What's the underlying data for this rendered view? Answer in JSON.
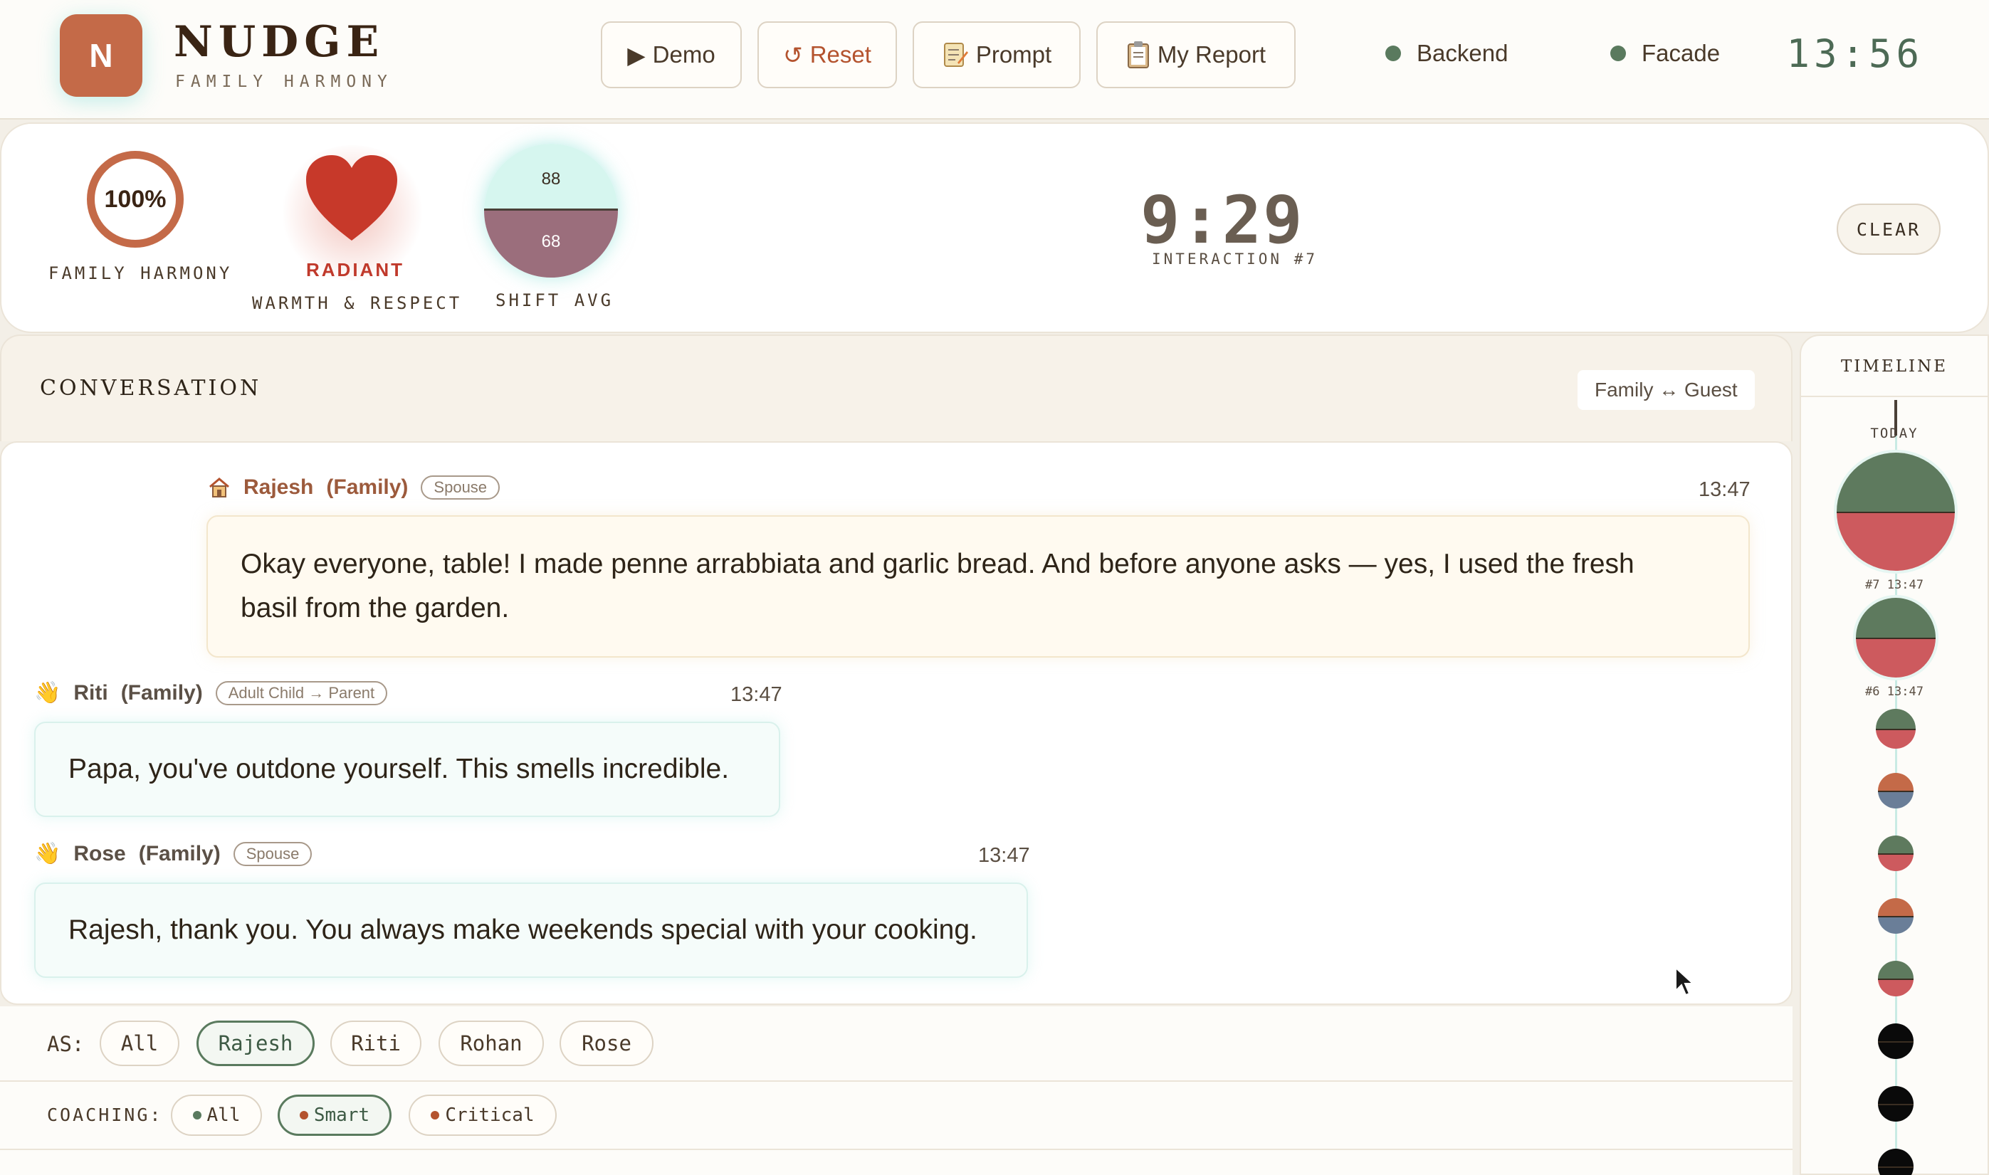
{
  "app": {
    "logo_letter": "N",
    "brand": "NUDGE",
    "subtitle": "FAMILY HARMONY",
    "clock": "13:56"
  },
  "toolbar": {
    "demo_label": "Demo",
    "reset_label": "Reset",
    "prompt_label": "Prompt",
    "report_label": "My Report"
  },
  "status": {
    "backend_label": "Backend",
    "facade_label": "Facade",
    "color": "#5a7a5e"
  },
  "metrics": {
    "harmony_value": "100%",
    "harmony_label": "FAMILY HARMONY",
    "warmth_state": "RADIANT",
    "warmth_label": "WARMTH & RESPECT",
    "shift_top": "88",
    "shift_bottom": "68",
    "shift_label": "SHIFT AVG",
    "timer": "9:29",
    "interaction": "INTERACTION #7",
    "clear_label": "CLEAR"
  },
  "conversation": {
    "title": "CONVERSATION",
    "mode": "Family ↔ Guest",
    "messages": [
      {
        "icon": "house-icon",
        "speaker": "Rajesh",
        "group": "(Family)",
        "relation": "Spouse",
        "time": "13:47",
        "line1": "Okay everyone, table! I made penne arrabbiata and garlic bread. And before anyone asks — yes, I used the fresh",
        "line2": "basil from the garden."
      },
      {
        "icon": "waving-hand-icon",
        "speaker": "Riti",
        "group": "(Family)",
        "relation": "Adult Child → Parent",
        "time": "13:47",
        "text": "Papa, you've outdone yourself. This smells incredible."
      },
      {
        "icon": "waving-hand-icon",
        "speaker": "Rose",
        "group": "(Family)",
        "relation": "Spouse",
        "time": "13:47",
        "text": "Rajesh, thank you. You always make weekends special with your cooking."
      }
    ]
  },
  "filters": {
    "as_label": "AS:",
    "as_options": [
      "All",
      "Rajesh",
      "Riti",
      "Rohan",
      "Rose"
    ],
    "as_selected": "Rajesh",
    "coaching_label": "COACHING:",
    "coaching_options": [
      "All",
      "Smart",
      "Critical"
    ],
    "coaching_selected": "Smart"
  },
  "timeline": {
    "title": "TIMELINE",
    "today": "TODAY",
    "nodes": [
      {
        "caption": "#7 13:47",
        "top_color": "#5e7a5e",
        "bottom_color": "#cd5a5e"
      },
      {
        "caption": "#6 13:47",
        "top_color": "#5e7a5e",
        "bottom_color": "#cd5a5e"
      },
      {
        "caption": "",
        "top_color": "#5e7a5e",
        "bottom_color": "#cd5a5e"
      },
      {
        "caption": "",
        "top_color": "#c46a48",
        "bottom_color": "#6a7e98"
      },
      {
        "caption": "",
        "top_color": "#5e7a5e",
        "bottom_color": "#cd5a5e"
      },
      {
        "caption": "",
        "top_color": "#c46a48",
        "bottom_color": "#6a7e98"
      },
      {
        "caption": "",
        "top_color": "#5e7a5e",
        "bottom_color": "#cd5a5e"
      },
      {
        "caption": "",
        "top_color": "#0a0a0a",
        "bottom_color": "#0a0a0a"
      },
      {
        "caption": "",
        "top_color": "#0a0a0a",
        "bottom_color": "#0a0a0a"
      },
      {
        "caption": "",
        "top_color": "#0a0a0a",
        "bottom_color": "#0a0a0a"
      }
    ]
  }
}
